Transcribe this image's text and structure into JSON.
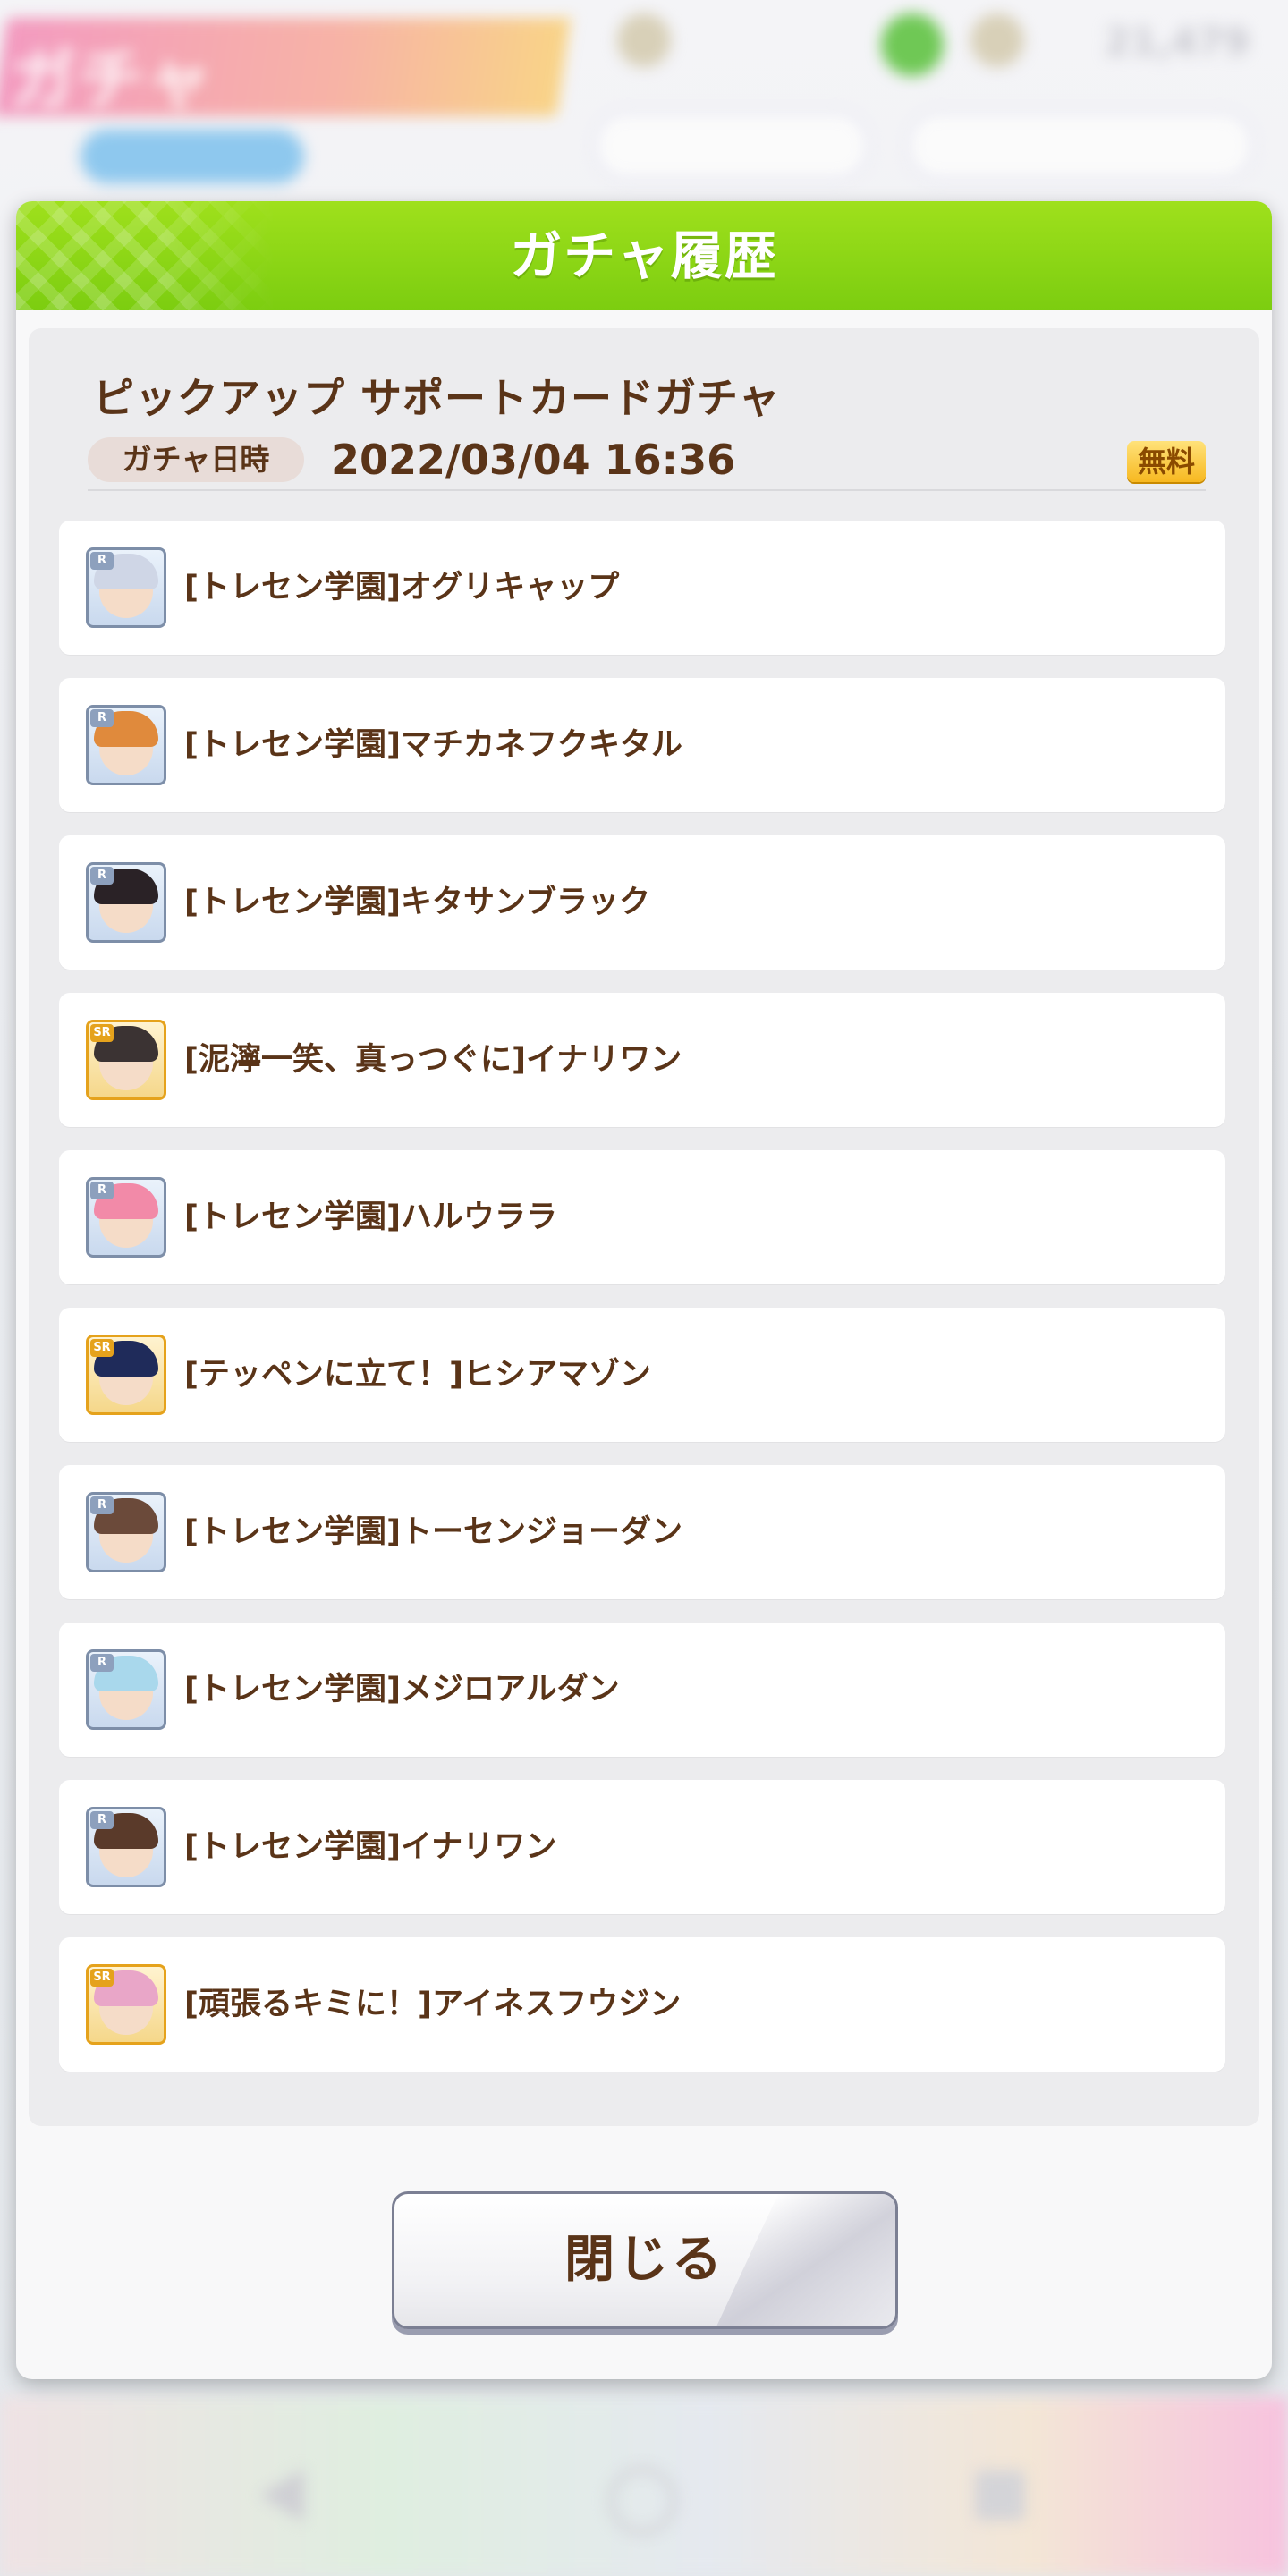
{
  "background": {
    "banner_title": "ガチャ",
    "currency_value": "21,479"
  },
  "dialog": {
    "title": "ガチャ履歴",
    "gacha_name": "ピックアップ サポートカードガチャ",
    "date_label": "ガチャ日時",
    "date_value": "2022/03/04 16:36",
    "free_badge": "無料",
    "close_label": "閉じる"
  },
  "results": [
    {
      "name": "[トレセン学園]オグリキャップ",
      "rarity": "R",
      "hair": "#cfd6e6"
    },
    {
      "name": "[トレセン学園]マチカネフクキタル",
      "rarity": "R",
      "hair": "#e08a3c"
    },
    {
      "name": "[トレセン学園]キタサンブラック",
      "rarity": "R",
      "hair": "#2a2226"
    },
    {
      "name": "[泥濘一笑、真っつぐに]イナリワン",
      "rarity": "SR",
      "hair": "#3b3333"
    },
    {
      "name": "[トレセン学園]ハルウララ",
      "rarity": "R",
      "hair": "#f28aa8"
    },
    {
      "name": "[テッペンに立て！]ヒシアマゾン",
      "rarity": "SR",
      "hair": "#1f2b5a"
    },
    {
      "name": "[トレセン学園]トーセンジョーダン",
      "rarity": "R",
      "hair": "#6b4a3a"
    },
    {
      "name": "[トレセン学園]メジロアルダン",
      "rarity": "R",
      "hair": "#a9d8ec"
    },
    {
      "name": "[トレセン学園]イナリワン",
      "rarity": "R",
      "hair": "#5a3a2a"
    },
    {
      "name": "[頑張るキミに！]アイネスフウジン",
      "rarity": "SR",
      "hair": "#e9a6c8"
    }
  ]
}
